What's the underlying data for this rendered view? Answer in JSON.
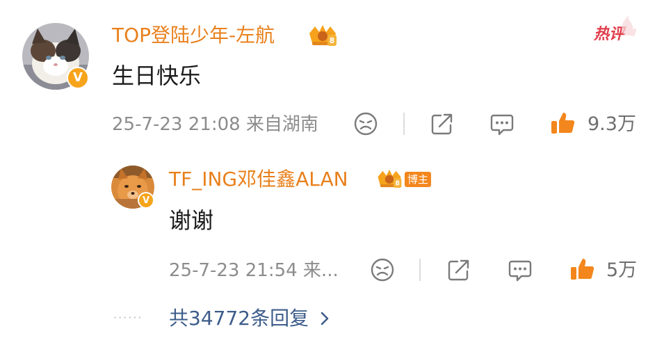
{
  "comment": {
    "username": "TOP登陆少年-左航",
    "text": "生日快乐",
    "hot_label": "热评",
    "time_location": "25-7-23 21:08 来自湖南",
    "likes": "9.3万",
    "avatar_icon": "cat-avatar",
    "verified_icon": "v-verified-icon"
  },
  "reply": {
    "username": "TF_ING邓佳鑫ALAN",
    "host_badge": "博主",
    "text": "谢谢",
    "time_location": "25-7-23 21:54 来...",
    "likes": "5万",
    "avatar_icon": "dog-avatar"
  },
  "replies_link": {
    "label": "共34772条回复",
    "dots": "······"
  },
  "colors": {
    "username": "#e8801c",
    "like": "#f3861c",
    "hot": "#e03c4a",
    "link": "#3d5c8a",
    "meta": "#8c8c8c"
  }
}
